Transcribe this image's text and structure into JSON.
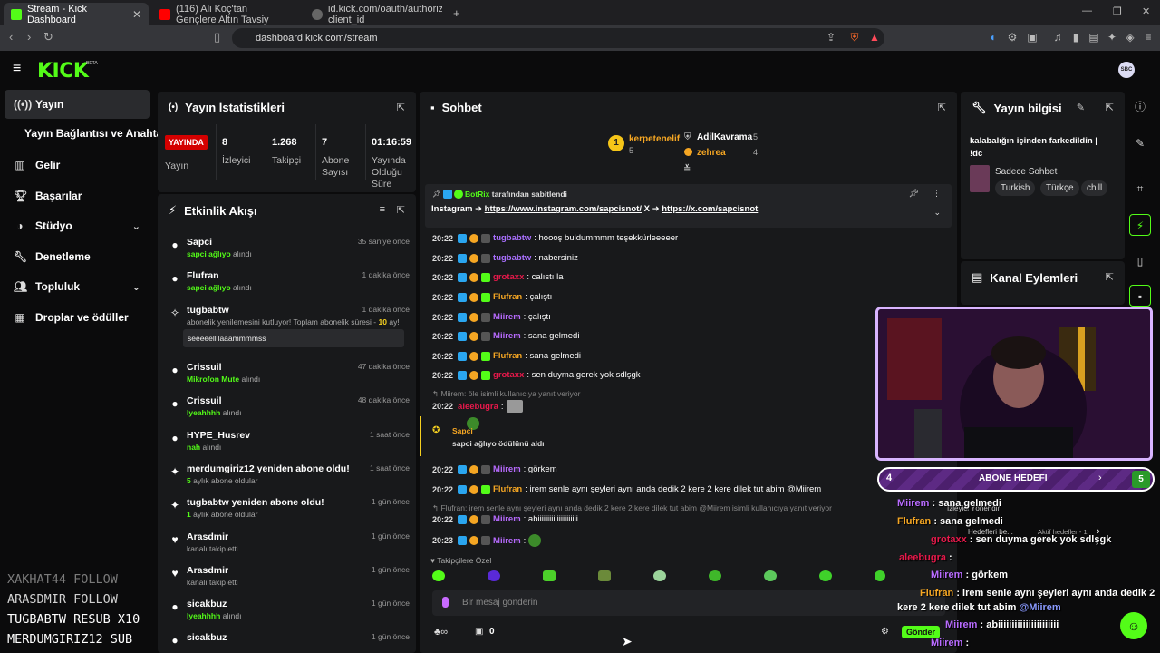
{
  "browser": {
    "tabs": [
      {
        "title": "Stream - Kick Dashboard",
        "fav_color": "#53fc18"
      },
      {
        "title": "(116) Ali Koç'tan Gençlere Altın Tavsiy",
        "fav_color": "#ff0000"
      },
      {
        "title": "id.kick.com/oauth/authorize?client_id",
        "fav_color": "#888888"
      }
    ],
    "url": "dashboard.kick.com/stream"
  },
  "header": {
    "logo": "KICK",
    "beta": "BETA",
    "avatar": "SBC"
  },
  "sidebar": {
    "items": [
      {
        "label": "Yayın",
        "icon": "broadcast-icon"
      },
      {
        "label": "Gelir",
        "icon": "chart-icon"
      },
      {
        "label": "Başarılar",
        "icon": "trophy-icon"
      },
      {
        "label": "Stüdyo",
        "icon": "palette-icon"
      },
      {
        "label": "Denetleme",
        "icon": "wrench-icon"
      },
      {
        "label": "Topluluk",
        "icon": "users-icon"
      },
      {
        "label": "Droplar ve ödüller",
        "icon": "gift-icon"
      }
    ],
    "sub_item": "Yayın Bağlantısı ve Anahtarı"
  },
  "event_log": [
    {
      "text": "XAKHAT44  FOLLOW",
      "color": "#7a7a7a"
    },
    {
      "text": "ARASDMIR  FOLLOW",
      "color": "#d0d0d0"
    },
    {
      "text": "TUGBABTW  RESUB X10",
      "color": "#ffffff"
    },
    {
      "text": "MERDUMGIRIZ12  SUB",
      "color": "#ffffff"
    }
  ],
  "stats": {
    "title": "Yayın İstatistikleri",
    "live": "YAYINDA",
    "live_label": "Yayın",
    "viewers": "8",
    "viewers_label": "İzleyici",
    "followers": "1.268",
    "followers_label": "Takipçi",
    "subs": "7",
    "subs_label": "Abone Sayısı",
    "duration": "01:16:59",
    "duration_label": "Yayında Olduğu Süre"
  },
  "activity": {
    "title": "Etkinlik Akışı",
    "items": [
      {
        "name": "Sapci",
        "sub_b": "sapci ağlıyo",
        "sub": " alındı",
        "time": "35 saniye önce",
        "icon": "reward-icon"
      },
      {
        "name": "Flufran",
        "sub_b": "sapci ağlıyo",
        "sub": " alındı",
        "time": "1 dakika önce",
        "icon": "reward-icon"
      },
      {
        "name": "tugbabtw",
        "sub_b": "",
        "sub": "abonelik yenilemesini kutluyor! Toplam abonelik süresi - ",
        "sub_tail": "10",
        "sub_end": " ay!",
        "msg": "seeeeellllaaammmmss",
        "time": "1 dakika önce",
        "icon": "party-icon"
      },
      {
        "name": "Crissuil",
        "sub_b": "Mikrofon Mute",
        "sub": " alındı",
        "time": "47 dakika önce",
        "icon": "reward-icon"
      },
      {
        "name": "Crissuil",
        "sub_b": "lyeahhhh",
        "sub": " alındı",
        "time": "48 dakika önce",
        "icon": "reward-icon"
      },
      {
        "name": "HYPE_Husrev",
        "sub_b": "nah",
        "sub": " alındı",
        "time": "1 saat önce",
        "icon": "reward-icon"
      },
      {
        "name": "merdumgiriz12 yeniden abone oldu!",
        "sub_b": "5",
        "sub": " aylık abone oldular",
        "time": "1 saat önce",
        "icon": "star-icon"
      },
      {
        "name": "tugbabtw yeniden abone oldu!",
        "sub_b": "1",
        "sub": " aylık abone oldular",
        "time": "1 gün önce",
        "icon": "star-icon"
      },
      {
        "name": "Arasdmir",
        "sub_b": "",
        "sub": "kanalı takip etti",
        "time": "1 gün önce",
        "icon": "heart-icon"
      },
      {
        "name": "Arasdmir",
        "sub_b": "",
        "sub": "kanalı takip etti",
        "time": "1 gün önce",
        "icon": "heart-icon"
      },
      {
        "name": "sicakbuz",
        "sub_b": "lyeahhhh",
        "sub": " alındı",
        "time": "1 gün önce",
        "icon": "reward-icon"
      },
      {
        "name": "sicakbuz",
        "sub_b": "",
        "sub": "",
        "time": "1 gün önce",
        "icon": "reward-icon"
      }
    ]
  },
  "chat": {
    "title": "Sohbet",
    "leaders": [
      {
        "name": "kerpetenelif",
        "count": "5"
      },
      {
        "name": "AdilKavrama",
        "count": "5"
      },
      {
        "name": "zehrea",
        "count": "4"
      }
    ],
    "pinned_by": "BotRix",
    "pinned_label": " tarafından sabitlendi",
    "pinned_pre": "Instagram ➜ ",
    "pinned_link1": "https://www.instagram.com/sapcisnot/",
    "pinned_mid": " X ➜ ",
    "pinned_link2": "https://x.com/sapcisnot",
    "messages": [
      {
        "time": "20:22",
        "user": "tugbabtw",
        "color": "#a970ff",
        "text": ": hoooş buldummmm teşekkürleeeeer"
      },
      {
        "time": "20:22",
        "user": "tugbabtw",
        "color": "#a970ff",
        "text": ": nabersiniz"
      },
      {
        "time": "20:22",
        "user": "grotaxx",
        "color": "#e8194b",
        "text": ": calıstı la"
      },
      {
        "time": "20:22",
        "user": "Flufran",
        "color": "#f5a623",
        "text": ": çalıştı"
      },
      {
        "time": "20:22",
        "user": "Miirem",
        "color": "#b86bff",
        "text": ": çalıştı"
      },
      {
        "time": "20:22",
        "user": "Miirem",
        "color": "#b86bff",
        "text": ": sana gelmedi"
      },
      {
        "time": "20:22",
        "user": "Flufran",
        "color": "#f5a623",
        "text": ": sana gelmedi"
      },
      {
        "time": "20:22",
        "user": "grotaxx",
        "color": "#e8194b",
        "text": ": sen duyma gerek yok sdlşgk"
      }
    ],
    "reply1": "Miirem: öle isimli kullanıcıya yanıt veriyor",
    "aleebugra": {
      "time": "20:22",
      "user": "aleebugra",
      "text": ":"
    },
    "reward": {
      "user": "Sapci",
      "text": "sapci ağlıyo ödülünü aldı"
    },
    "messages2": [
      {
        "time": "20:22",
        "user": "Miirem",
        "color": "#b86bff",
        "text": ": görkem"
      },
      {
        "time": "20:22",
        "user": "Flufran",
        "color": "#f5a623",
        "text": ": irem senle aynı şeyleri aynı anda dedik 2 kere 2 kere dilek tut abim @Miirem"
      }
    ],
    "reply2": "Flufran: irem senle aynı şeyleri aynı anda dedik 2 kere 2 kere dilek tut abim @Miirem isimli kullanıcıya yanıt veriyor",
    "messages3": [
      {
        "time": "20:22",
        "user": "Miirem",
        "color": "#b86bff",
        "text": ": abiiiiiiiiiiiiiiiiiiiii"
      },
      {
        "time": "20:23",
        "user": "Miirem",
        "color": "#b86bff",
        "text": ":"
      }
    ],
    "emote_title": "Takipçilere Özel",
    "placeholder": "Bir mesaj gönderin",
    "points": "0",
    "send": "Gönder"
  },
  "info": {
    "title": "Yayın bilgisi",
    "stream_title_line1": "kalabalığın içinden farkedildin |",
    "stream_title_line2": "!dc",
    "category": "Sadece Sohbet",
    "tags": [
      "Turkish",
      "Türkçe",
      "chill"
    ]
  },
  "channel_actions": {
    "title": "Kanal Eylemleri"
  },
  "sub_goal": {
    "left": "4",
    "label": "ABONE HEDEFI",
    "right": "5",
    "progress": 0.8
  },
  "overlay_chat": [
    {
      "user": "Miirem",
      "color": "#b86bff",
      "text": " : sana gelmedi"
    },
    {
      "user": "Flufran",
      "color": "#f5a623",
      "text": " : sana gelmedi"
    },
    {
      "user": "grotaxx",
      "color": "#e8194b",
      "text": " : sen duyma gerek yok sdlşgk"
    },
    {
      "user": "aleebugra",
      "color": "#e8194b",
      "text": " :"
    },
    {
      "user": "Miirem",
      "color": "#b86bff",
      "text": " : görkem"
    },
    {
      "user": "Flufran",
      "color": "#f5a623",
      "text": " : irem senle aynı şeyleri aynı anda dedik 2"
    },
    {
      "user": "",
      "color": "#ffffff",
      "text": "kere 2 kere dilek tut abim "
    },
    {
      "user": "Miirem",
      "color": "#b86bff",
      "text": " : abiiiiiiiiiiiiiiiiiiiiii"
    },
    {
      "user": "Miirem",
      "color": "#b86bff",
      "text": " :"
    }
  ],
  "overlay_extra": {
    "viewers_label": "İzleyici Yönendir",
    "goals": "Hedefleri be...",
    "active": "Aktif hedefler - 1",
    "mention": "@Miirem"
  },
  "colors": {
    "brand": "#53fc18",
    "live": "#d40000",
    "panel": "#18191b"
  }
}
